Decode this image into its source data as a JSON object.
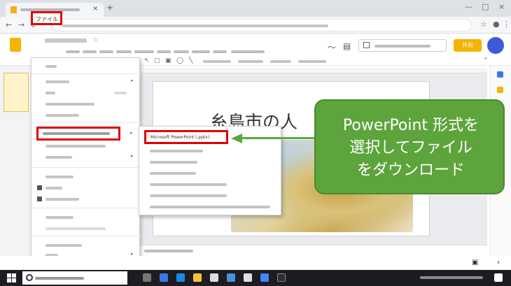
{
  "browser": {
    "tab_title": "",
    "tab_close": "×",
    "new_tab": "+",
    "window_controls": [
      "—",
      "□",
      "×"
    ],
    "nav_icons": [
      "←",
      "→",
      "⟳"
    ],
    "url": ""
  },
  "app": {
    "doc_title": "",
    "menu": {
      "file": "ファイル",
      "items": [
        "",
        "",
        "",
        "",
        "",
        "",
        "",
        "",
        "",
        ""
      ]
    },
    "present_button": "",
    "share_button": "共有",
    "avatar": ""
  },
  "file_menu": {
    "download_item": ""
  },
  "download_submenu": {
    "pptx": "Microsoft PowerPoint (.pptx)"
  },
  "slide": {
    "title": "糸島市の人"
  },
  "callout": {
    "line1": "PowerPoint 形式を",
    "line2": "選択してファイル",
    "line3": "をダウンロード"
  },
  "colors": {
    "callout": "#5ea43d",
    "highlight": "#e00000",
    "brand": "#f4b400",
    "avatar": "#3d5bd6"
  },
  "taskbar": {
    "search_placeholder": ""
  }
}
